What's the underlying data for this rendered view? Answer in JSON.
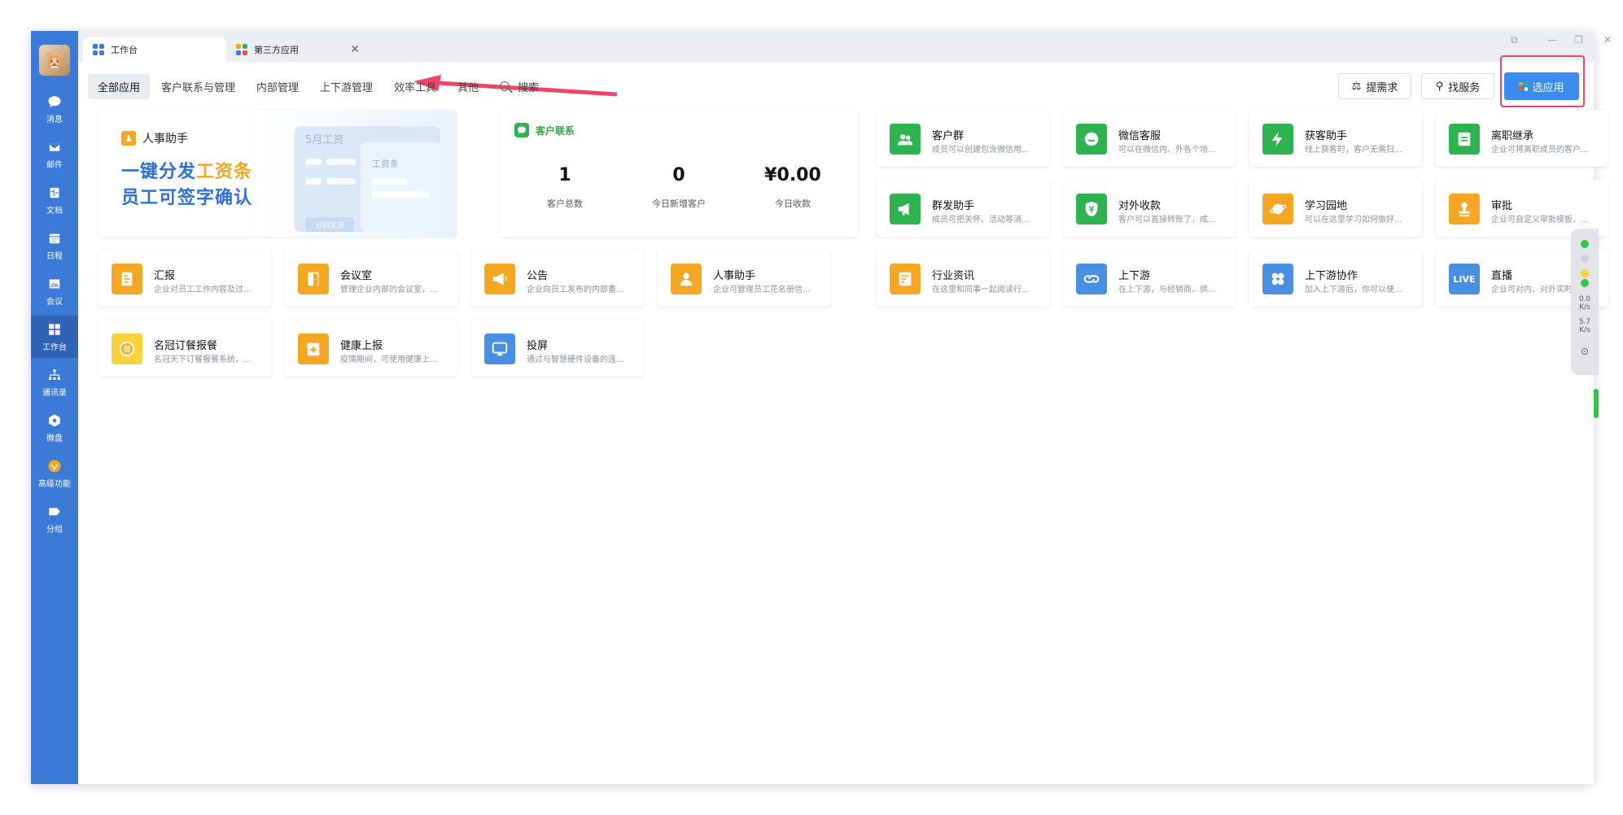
{
  "sidebar": {
    "items": [
      {
        "label": "消息",
        "icon": "chat-icon"
      },
      {
        "label": "邮件",
        "icon": "mail-icon"
      },
      {
        "label": "文档",
        "icon": "document-icon"
      },
      {
        "label": "日程",
        "icon": "calendar-icon"
      },
      {
        "label": "会议",
        "icon": "meeting-icon"
      },
      {
        "label": "工作台",
        "icon": "workbench-icon"
      },
      {
        "label": "通讯录",
        "icon": "contacts-icon"
      },
      {
        "label": "微盘",
        "icon": "drive-icon"
      },
      {
        "label": "高级功能",
        "icon": "premium-icon"
      },
      {
        "label": "分组",
        "icon": "tag-icon"
      }
    ]
  },
  "tabs": [
    {
      "label": "工作台"
    },
    {
      "label": "第三方应用"
    }
  ],
  "nav": {
    "items": [
      "全部应用",
      "客户联系与管理",
      "内部管理",
      "上下游管理",
      "效率工具",
      "其他"
    ],
    "search": "搜索"
  },
  "buttons": {
    "request": "提需求",
    "service": "找服务",
    "choose": "选应用"
  },
  "banner": {
    "tag": "人事助手",
    "line1_a": "一键分发",
    "line1_b": "工资条",
    "line2": "员工可签字确认",
    "mock_title": "5月工资",
    "mock_inner": "工资条",
    "mock_btn": "分别发送"
  },
  "customer": {
    "title": "客户联系",
    "stats": [
      {
        "value": "1",
        "label": "客户总数"
      },
      {
        "value": "0",
        "label": "今日新增客户"
      },
      {
        "value": "¥0.00",
        "label": "今日收款"
      }
    ]
  },
  "apps": [
    {
      "name": "客户群",
      "desc": "成员可以创建包含微信用...",
      "color": "#2fb350",
      "icon": "group-icon"
    },
    {
      "name": "微信客服",
      "desc": "可以在微信内、外各个场...",
      "color": "#2fb350",
      "icon": "wechat-service-icon"
    },
    {
      "name": "获客助手",
      "desc": "线上获客时，客户无需扫...",
      "color": "#2fb350",
      "icon": "lightning-icon"
    },
    {
      "name": "离职继承",
      "desc": "企业可将离职成员的客户...",
      "color": "#2fb350",
      "icon": "transfer-icon"
    },
    {
      "name": "群发助手",
      "desc": "成员可把关怀、活动等消...",
      "color": "#2fb350",
      "icon": "megaphone-icon"
    },
    {
      "name": "对外收款",
      "desc": "客户可以直接转账了，成...",
      "color": "#2fb350",
      "icon": "payment-icon"
    },
    {
      "name": "学习园地",
      "desc": "可以在这里学习如何做好...",
      "color": "#f5a623",
      "icon": "planet-icon"
    },
    {
      "name": "审批",
      "desc": "企业可自定义审批模板，...",
      "color": "#f5a623",
      "icon": "approval-icon"
    },
    {
      "name": "汇报",
      "desc": "企业对员工工作内容及过...",
      "color": "#f5a623",
      "icon": "report-icon"
    },
    {
      "name": "会议室",
      "desc": "管理企业内部的会议室，...",
      "color": "#f5a623",
      "icon": "door-icon"
    },
    {
      "name": "公告",
      "desc": "企业向员工发布的内部重...",
      "color": "#f5a623",
      "icon": "announce-icon"
    },
    {
      "name": "人事助手",
      "desc": "企业可管理员工花名册信...",
      "color": "#f5a623",
      "icon": "hr-icon"
    },
    {
      "name": "行业资讯",
      "desc": "在这里和同事一起阅读行...",
      "color": "#f5a623",
      "icon": "news-icon"
    },
    {
      "name": "上下游",
      "desc": "在上下游，与经销商、供...",
      "color": "#4a90e2",
      "icon": "link-icon"
    },
    {
      "name": "上下游协作",
      "desc": "加入上下游后，你可以便...",
      "color": "#4a90e2",
      "icon": "clover-icon"
    },
    {
      "name": "直播",
      "desc": "企业可对内、对外实时分...",
      "color": "#4a90e2",
      "icon": "live-icon"
    },
    {
      "name": "名冠订餐报餐",
      "desc": "名冠天下订餐报餐系统，...",
      "color": "#f7d23a",
      "icon": "meal-icon"
    },
    {
      "name": "健康上报",
      "desc": "疫情期间，可使用健康上...",
      "color": "#f5a623",
      "icon": "health-icon"
    },
    {
      "name": "投屏",
      "desc": "通过与智慧硬件设备的连...",
      "color": "#4a90e2",
      "icon": "cast-icon"
    }
  ],
  "live_label": "LIVE",
  "widget": {
    "up": "0.0",
    "up_unit": "K/s",
    "down": "5.7",
    "down_unit": "K/s"
  }
}
